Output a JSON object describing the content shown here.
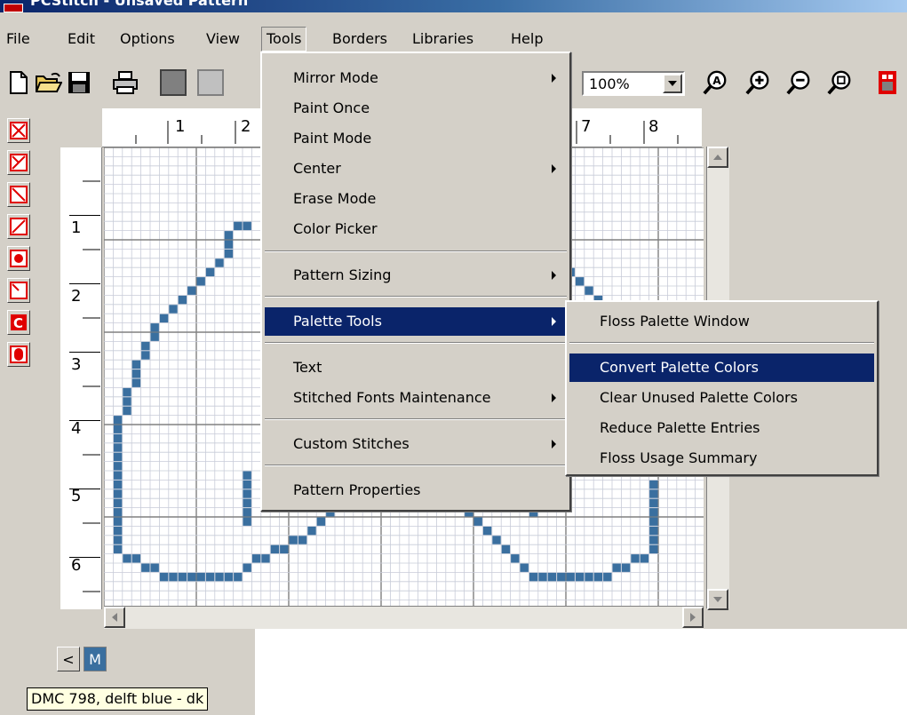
{
  "window": {
    "title": "PCStitch - Unsaved Pattern"
  },
  "menubar": {
    "items": [
      "File",
      "Edit",
      "Options",
      "View",
      "Tools",
      "Borders",
      "Libraries",
      "Help"
    ],
    "open": "Tools"
  },
  "toolbar": {
    "zoom_value": "100%",
    "buttons": [
      "new-file-icon",
      "open-folder-icon",
      "save-disk-icon",
      "print-icon",
      "color-swatch-icon",
      "zoom-fit-icon",
      "zoom-in-icon",
      "zoom-out-icon",
      "zoom-window-icon",
      "library-icon"
    ]
  },
  "stitch_tools": [
    "full-stitch-icon",
    "three-quarter-stitch-icon",
    "backstitch-down-icon",
    "backstitch-up-icon",
    "french-knot-icon",
    "quarter-stitch-icon",
    "c-stitch-icon",
    "bead-icon"
  ],
  "ruler_top": [
    "1",
    "2",
    "7",
    "8"
  ],
  "ruler_left": [
    "1",
    "2",
    "3",
    "4",
    "5",
    "6"
  ],
  "tools_menu": {
    "items": [
      "Mirror Mode",
      "Paint Once",
      "Paint Mode",
      "Center",
      "Erase Mode",
      "Color Picker",
      "Pattern Sizing",
      "Palette Tools",
      "Text",
      "Stitched Fonts Maintenance",
      "Custom Stitches",
      "Pattern Properties"
    ],
    "highlighted": "Palette Tools"
  },
  "palette_submenu": {
    "items": [
      "Floss Palette Window",
      "Convert Palette Colors",
      "Clear Unused Palette Colors",
      "Reduce Palette Entries",
      "Floss Usage Summary"
    ],
    "highlighted": "Convert Palette Colors"
  },
  "palette_nav": {
    "prev_label": "<",
    "mode_label": "M"
  },
  "tooltip": "DMC 798, delft blue - dk",
  "colors": {
    "stitch": "#3a6f9f",
    "menu_highlight": "#0a246a",
    "tool_red": "#e00000"
  }
}
